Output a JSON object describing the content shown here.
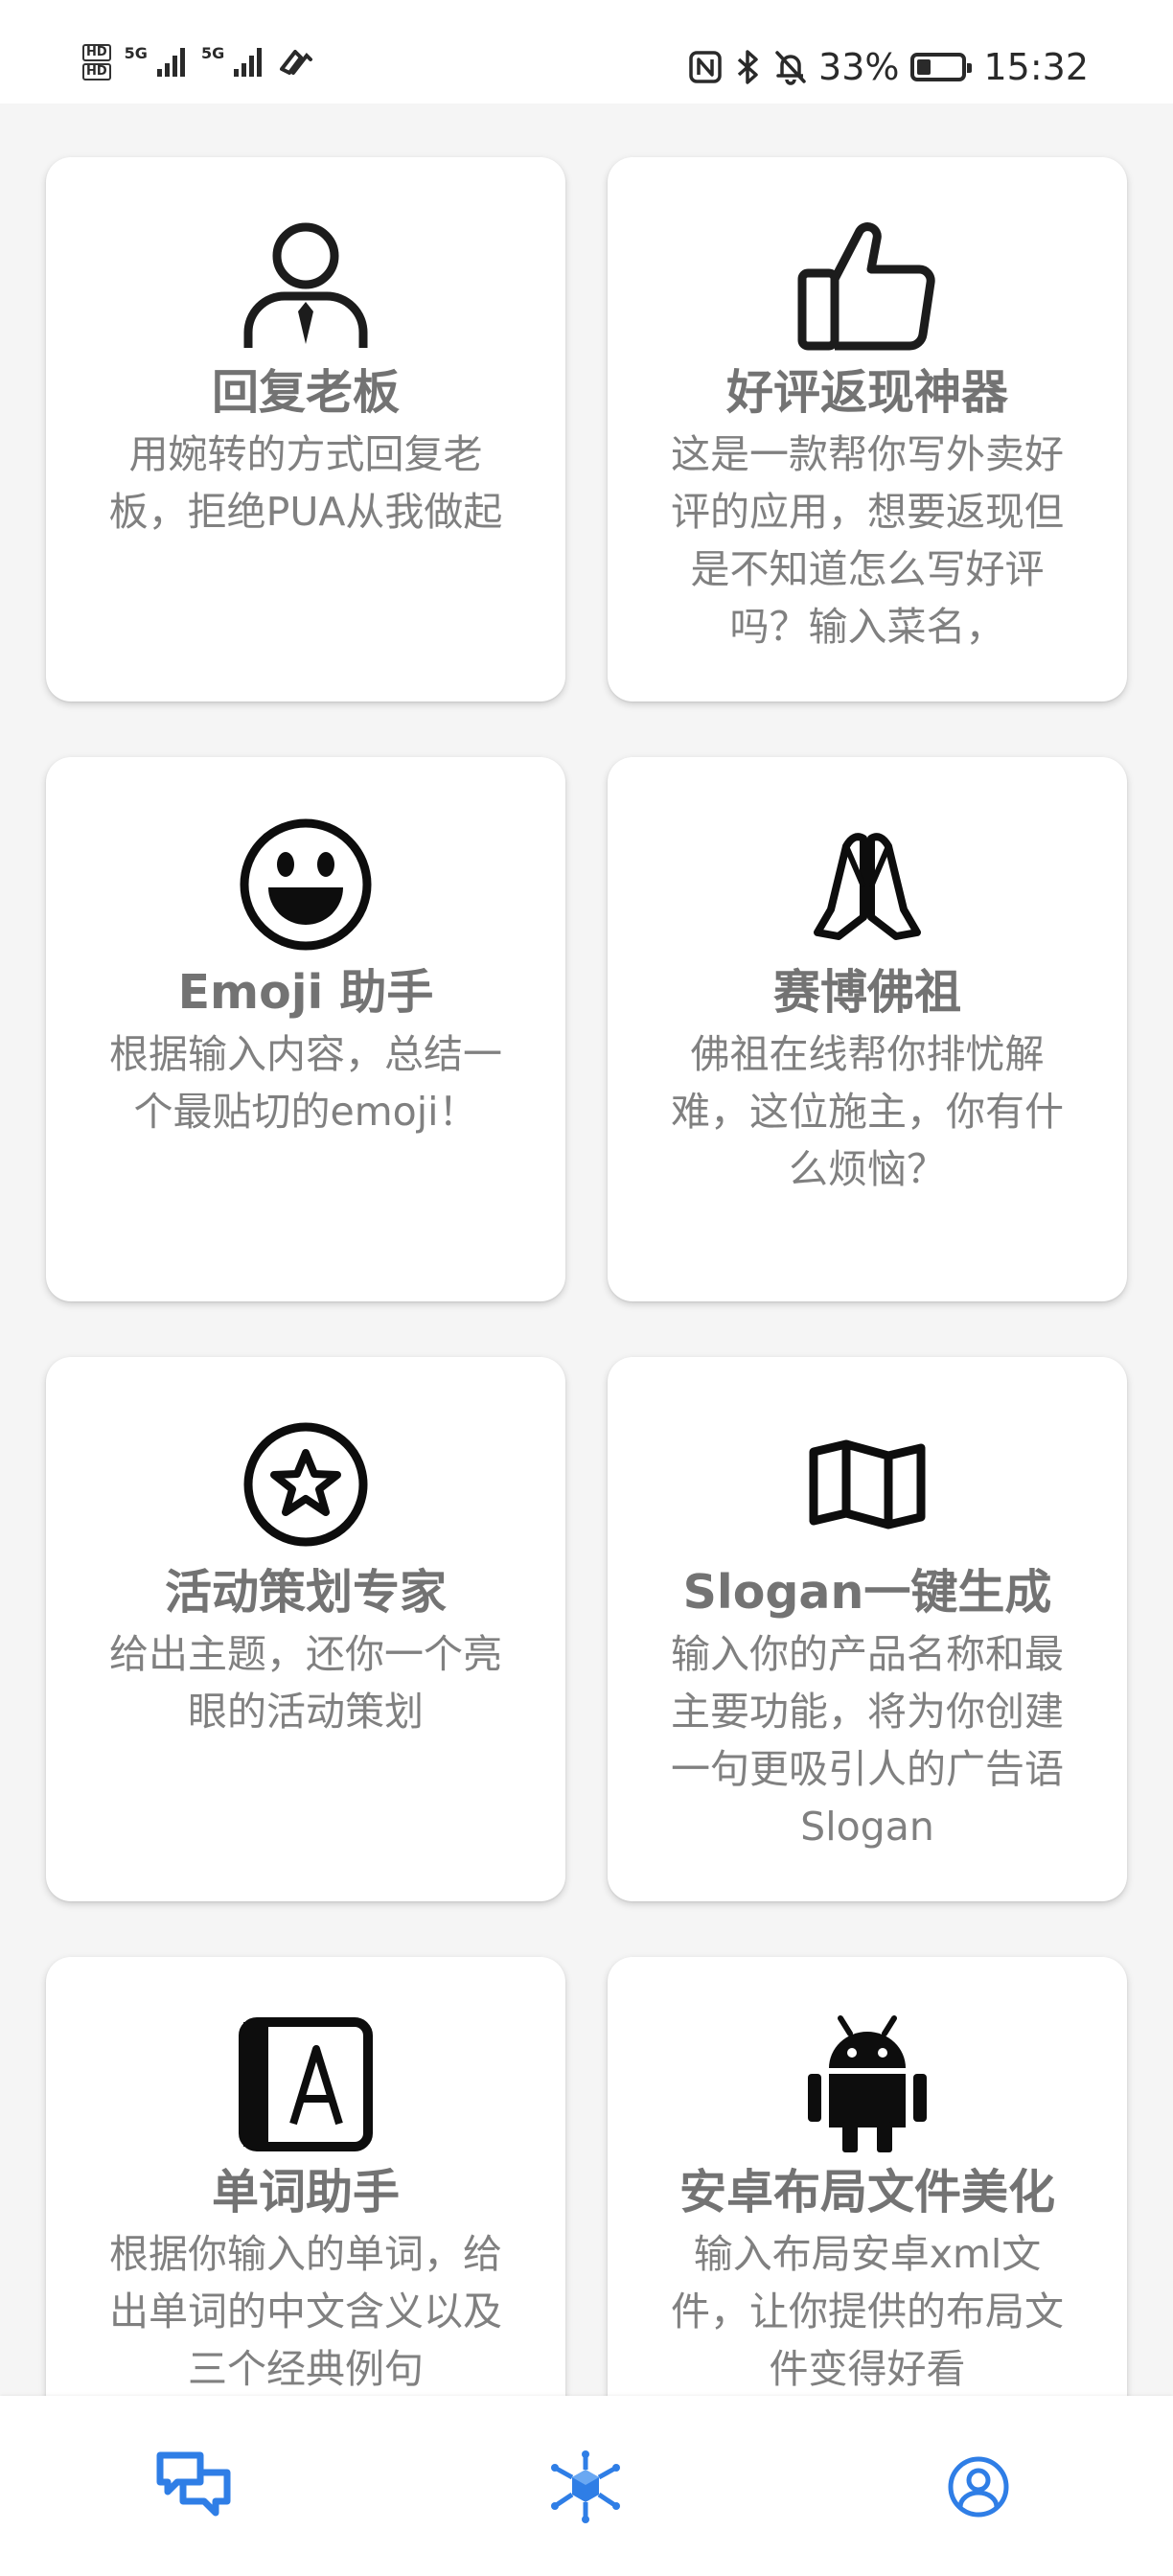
{
  "status_bar": {
    "network_labels": [
      "HD",
      "HD",
      "5G",
      "5G"
    ],
    "battery_percent": "33%",
    "time": "15:32"
  },
  "cards": [
    {
      "icon": "person-tie-icon",
      "title": "回复老板",
      "description": "用婉转的方式回复老板，拒绝PUA从我做起"
    },
    {
      "icon": "thumbs-up-icon",
      "title": "好评返现神器",
      "description": "这是一款帮你写外卖好评的应用，想要返现但是不知道怎么写好评吗？输入菜名，"
    },
    {
      "icon": "smiley-face-icon",
      "title": "Emoji 助手",
      "description": "根据输入内容，总结一个最贴切的emoji！"
    },
    {
      "icon": "praying-hands-icon",
      "title": "赛博佛祖",
      "description": "佛祖在线帮你排忧解难，这位施主，你有什么烦恼？"
    },
    {
      "icon": "star-circle-icon",
      "title": "活动策划专家",
      "description": "给出主题，还你一个亮眼的活动策划"
    },
    {
      "icon": "map-icon",
      "title": "Slogan一键生成",
      "description": "输入你的产品名称和最主要功能，将为你创建一句更吸引人的广告语Slogan"
    },
    {
      "icon": "dictionary-icon",
      "title": "单词助手",
      "description": "根据你输入的单词，给出单词的中文含义以及三个经典例句"
    },
    {
      "icon": "android-icon",
      "title": "安卓布局文件美化",
      "description": "输入布局安卓xml文件，让你提供的布局文件变得好看"
    }
  ],
  "bottom_nav": [
    {
      "icon": "chat-bubbles-icon",
      "active": true
    },
    {
      "icon": "cube-network-icon",
      "active": false
    },
    {
      "icon": "user-profile-icon",
      "active": false
    }
  ],
  "colors": {
    "accent": "#2f7ee6",
    "icon_dark": "#1c1c1c",
    "title": "#737373",
    "description": "#808080",
    "background": "#f5f5f5"
  }
}
